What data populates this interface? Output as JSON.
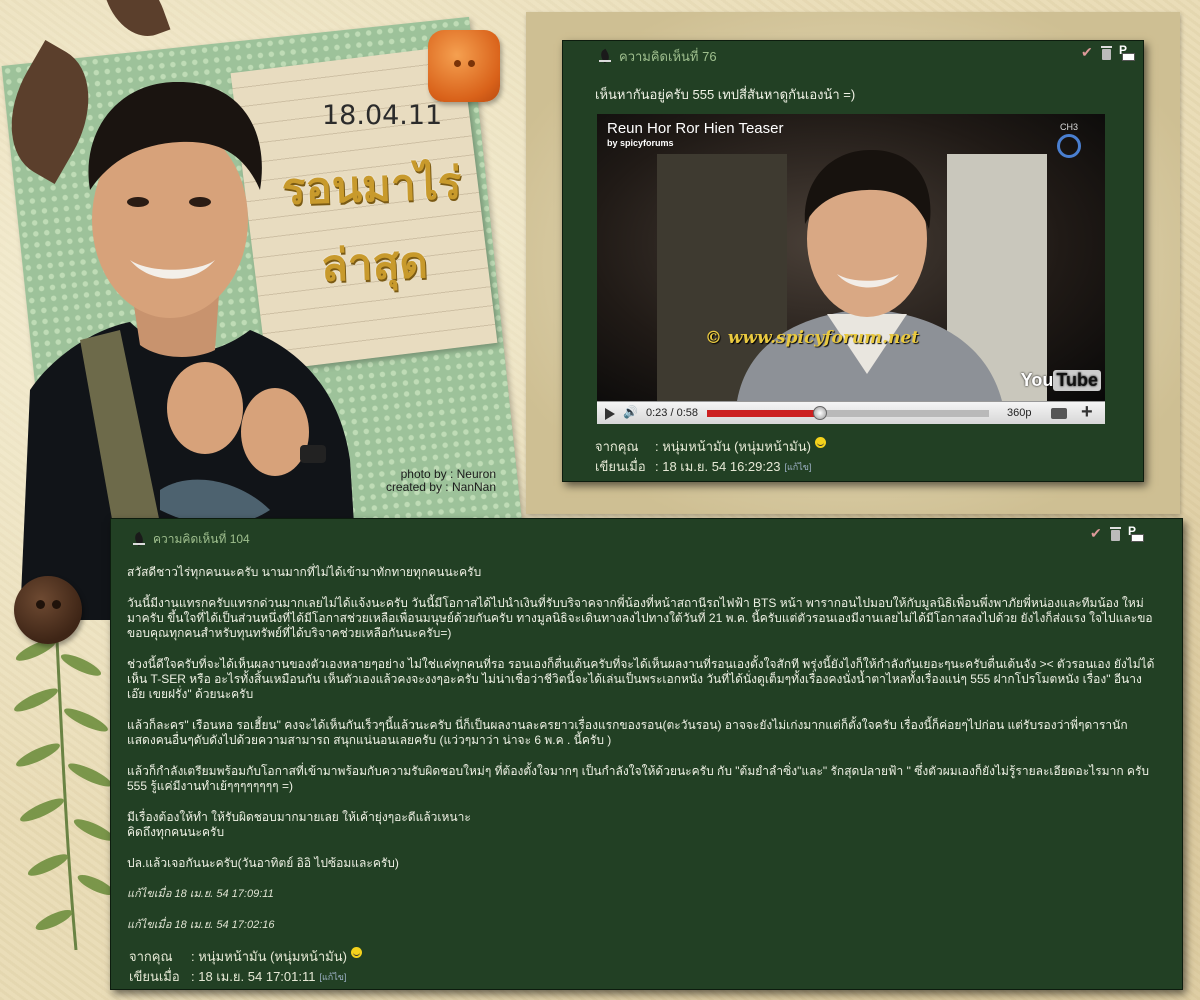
{
  "header": {
    "date": "18.04.11",
    "title_line1": "รอนมาไร่",
    "title_line2": "ล่าสุด",
    "credit_photo": "photo by : Neuron",
    "credit_created": "created by : NanNan"
  },
  "comment_76": {
    "heading": "ความคิดเห็นที่ 76",
    "text": "เห็นหากันอยู่ครับ 555 เทปสี่สันหาดูกันเองน้า =)",
    "video": {
      "title": "Reun Hor Ror Hien Teaser",
      "by": "by spicyforums",
      "watermark": "© www.spicyforum.net",
      "channel": "CH3",
      "youtube_prefix": "You",
      "youtube_suffix": "Tube",
      "time": "0:23 / 0:58",
      "progress": 0.4,
      "quality": "360p"
    },
    "from_label": "จากคุณ",
    "from_value": ": หนุ่มหน้ามัน (หนุ่มหน้ามัน)",
    "written_label": "เขียนเมื่อ",
    "written_value": ": 18 เม.ย. 54 16:29:23",
    "edit_label": "[แก้ไข]"
  },
  "comment_104": {
    "heading": "ความคิดเห็นที่ 104",
    "paragraphs": [
      "สวัสดีชาวไร่ทุกคนนะครับ  นานมากที่ไม่ได้เข้ามาทักทายทุกคนนะครับ",
      "วันนี้มีงานแทรกครับแทรกด่วนมากเลยไม่ได้แจ้งนะครับ วันนี้มีโอกาสได้ไปนำเงินที่รับบริจาคจากพี่น้องที่หน้าสถานีรถไฟฟ้า BTS หน้า พารากอนไปมอบให้กับมูลนิธิเพื่อนพึ่งพาภัยพี่หน่องและทีมน้อง ใหม่มาครับ ขึ้นใจที่ได้เป็นส่วนหนึ่งที่ได้มีโอกาสช่วยเหลือเพื่อนมนุษย์ด้วยกันครับ ทางมูลนิธิจะเดินทางลงไปทางใต้วันที่ 21 พ.ค. นี้ครับแต่ตัวรอนเองมีงานเลยไม่ได้มีโอกาสลงไปด้วย ยังไงก็ส่งแรง ใจไปและขอขอบคุณทุกคนสำหรับทุนทรัพย์ที่ได้บริจาคช่วยเหลือกันนะครับ=)",
      "ช่วงนี้ดีใจครับที่จะได้เห็นผลงานของตัวเองหลายๆอย่าง ไม่ใช่แค่ทุกคนที่รอ รอนเองก็ตื่นเต้นครับที่จะได้เห็นผลงานที่รอนเองตั้งใจสักที พรุ่งนี้ยังไงก็ให้กำลังกันเยอะๆนะครับตื่นเต้นจัง >< ตัวรอนเอง ยังไม่ได้เห็น T-SER หรือ อะไรทั้งสิ้นเหมือนกัน เห็นตัวเองแล้วคงจะงงๆอะครับ ไม่น่าเชื่อว่าชีวิตนี้จะได้เล่นเป็นพระเอกหนัง วันที่ได้นั่งดูเต็มๆทั้งเรื่องคงนั่งน้ำตาไหลทั้งเรื่องแน่ๆ 555 ฝากโปรโมตหนัง เรื่อง\" อีนางเอ๊ย เขยฝรั่ง\" ด้วยนะครับ",
      "แล้วก็ละคร\" เรือนหอ รอเฮี้ยน\" คงจะได้เห็นกันเร็วๆนี้แล้วนะครับ นี่ก็เป็นผลงานละครยาวเรื่องแรกของรอน(ตะวันรอน) อาจจะยังไม่เก่งมากแต่ก็ตั้งใจครับ เรื่องนี้ก็ค่อยๆไปก่อน แต่รับรองว่าพี่ๆดารานัก แสดงคนอื่นๆดับดังไปด้วยความสามารถ สนุกแน่นอนเลยครับ (แว่วๆมาว่า น่าจะ 6 พ.ค . นี้ครับ )",
      "แล้วก็กำลังเตรียมพร้อมกับโอกาสที่เข้ามาพร้อมกับความรับผิดชอบใหม่ๆ ที่ต้องตั้งใจมากๆ เป็นกำลังใจให้ด้วยนะครับ กับ \"ต้มยำลำซิ่ง\"และ\" รักสุดปลายฟ้า \" ซึ่งตัวผมเองก็ยังไม่รู้รายละเอียดอะไรมาก ครับ 555 รู้แค่มีงานทำเย้ๆๆๆๆๆๆๆๆ =)"
    ],
    "line_a": "มีเรื่องต้องให้ทำ  ให้รับผิดชอบมากมายเลย  ให้เค้ายุ่งๆอะดีแล้วเหนาะ",
    "line_b": "คิดถึงทุกคนนะครับ",
    "signoff": "ปล.แล้วเจอกันนะครับ(วันอาทิตย์ อิอิ ไปซ้อมและครับ)",
    "edited_1": "แก้ไขเมื่อ 18 เม.ย. 54 17:09:11",
    "edited_2": "แก้ไขเมื่อ 18 เม.ย. 54 17:02:16",
    "from_label": "จากคุณ",
    "from_value": ": หนุ่มหน้ามัน (หนุ่มหน้ามัน)",
    "written_label": "เขียนเมื่อ",
    "written_value": ": 18 เม.ย. 54 17:01:11",
    "edit_label": "[แก้ไข]"
  },
  "colors": {
    "comment_bg": "#224024",
    "heading_text": "#9fbf8e",
    "title_gold": "#c89a2c",
    "progress_red": "#cc2020"
  }
}
